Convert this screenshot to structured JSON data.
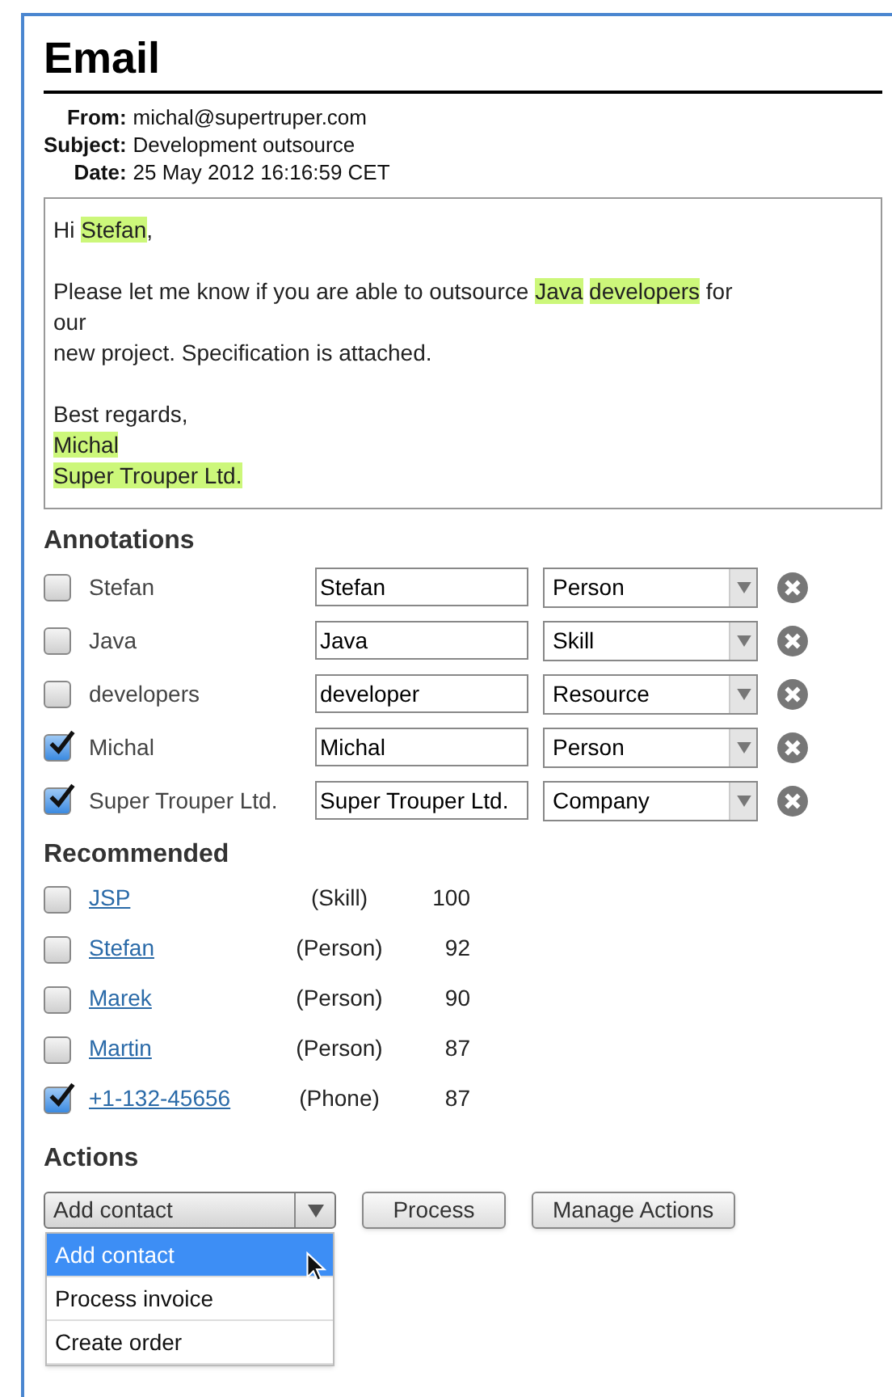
{
  "title": "Email",
  "headers": [
    {
      "label": "From:",
      "value": "michal@supertruper.com"
    },
    {
      "label": "Subject:",
      "value": "Development outsource"
    },
    {
      "label": "Date:",
      "value": "25 May 2012 16:16:59 CET"
    }
  ],
  "body": [
    {
      "kind": "text",
      "segments": [
        {
          "text": "Hi ",
          "highlight": false
        },
        {
          "text": "Stefan",
          "highlight": true
        },
        {
          "text": ",",
          "highlight": false
        }
      ]
    },
    {
      "kind": "blank"
    },
    {
      "kind": "text",
      "segments": [
        {
          "text": "Please let me know if you are able to outsource ",
          "highlight": false
        },
        {
          "text": "Java",
          "highlight": true,
          "space_after": true
        },
        {
          "text": "developers",
          "highlight": true
        },
        {
          "text": " for",
          "highlight": false
        }
      ]
    },
    {
      "kind": "text",
      "segments": [
        {
          "text": "our",
          "highlight": false
        }
      ]
    },
    {
      "kind": "text",
      "segments": [
        {
          "text": "new project. Specification is attached.",
          "highlight": false
        }
      ]
    },
    {
      "kind": "blank"
    },
    {
      "kind": "text",
      "segments": [
        {
          "text": "Best regards,",
          "highlight": false
        }
      ]
    },
    {
      "kind": "text",
      "segments": [
        {
          "text": "Michal",
          "highlight": true
        }
      ]
    },
    {
      "kind": "text",
      "segments": [
        {
          "text": "Super Trouper Ltd.",
          "highlight": true
        }
      ]
    }
  ],
  "annotations": {
    "heading": "Annotations",
    "rows": [
      {
        "label": "Stefan",
        "checked": false,
        "value": "Stefan",
        "type": "Person"
      },
      {
        "label": "Java",
        "checked": false,
        "value": "Java",
        "type": "Skill"
      },
      {
        "label": "developers",
        "checked": false,
        "value": "developer",
        "type": "Resource"
      },
      {
        "label": "Michal",
        "checked": true,
        "value": "Michal",
        "type": "Person"
      },
      {
        "label": "Super Trouper Ltd.",
        "checked": true,
        "value": "Super Trouper Ltd.",
        "type": "Company"
      }
    ]
  },
  "recommended": {
    "heading": "Recommended",
    "rows": [
      {
        "name": "JSP",
        "checked": false,
        "type": "(Skill)",
        "score": "100"
      },
      {
        "name": "Stefan",
        "checked": false,
        "type": "(Person)",
        "score": "92"
      },
      {
        "name": "Marek",
        "checked": false,
        "type": "(Person)",
        "score": "90"
      },
      {
        "name": "Martin",
        "checked": false,
        "type": "(Person)",
        "score": "87"
      },
      {
        "name": "+1-132-45656",
        "checked": true,
        "type": "(Phone)",
        "score": "87"
      }
    ]
  },
  "actions": {
    "heading": "Actions",
    "select_value": "Add contact",
    "expanded": true,
    "options": [
      {
        "label": "Add contact",
        "selected": true
      },
      {
        "label": "Process invoice",
        "selected": false
      },
      {
        "label": "Create order",
        "selected": false
      }
    ],
    "buttons": [
      "Process",
      "Manage Actions"
    ]
  }
}
